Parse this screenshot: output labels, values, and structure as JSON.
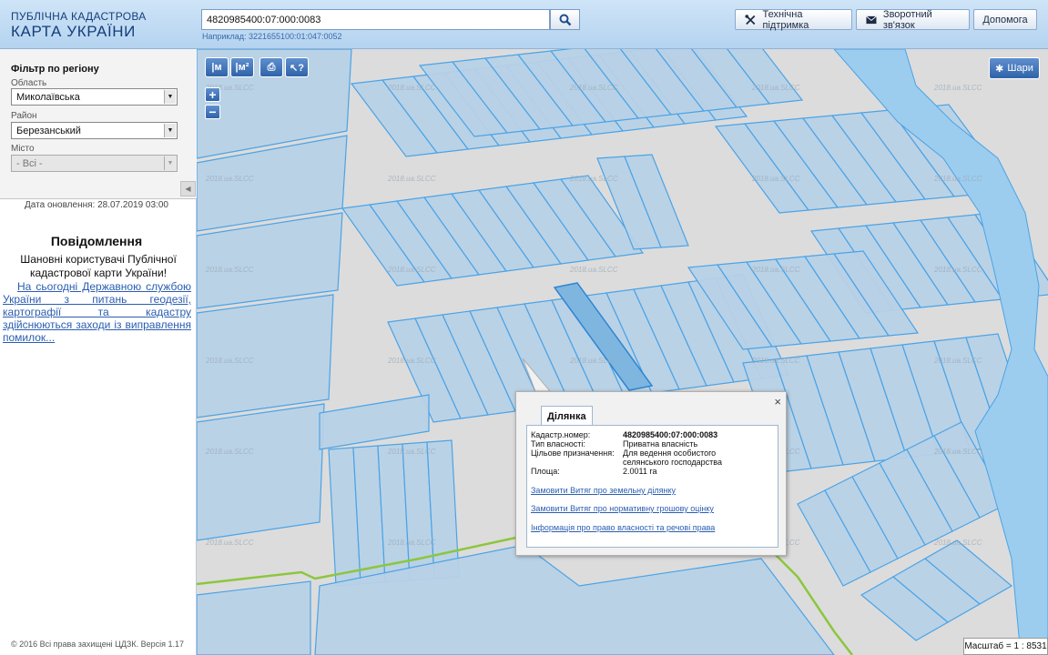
{
  "header": {
    "logo_line1": "ПУБЛІЧНА КАДАСТРОВА",
    "logo_line2": "КАРТА УКРАЇНИ",
    "search_value": "4820985400:07:000:0083",
    "example": "Наприклад: 3221655100:01:047:0052",
    "buttons": {
      "support": "Технічна підтримка",
      "feedback": "Зворотний зв'язок",
      "help": "Допомога"
    }
  },
  "sidebar": {
    "filter_title": "Фільтр по регіону",
    "oblast_label": "Область",
    "oblast_value": "Миколаївська",
    "rayon_label": "Район",
    "rayon_value": "Березанський",
    "city_label": "Місто",
    "city_value": "- Всі -",
    "updated": "Дата оновлення: 28.07.2019 03:00",
    "notice_title": "Повідомлення",
    "notice_text": "Шановні користувачі Публічної кадастрової карти України!",
    "notice_link": "На сьогодні Державною службою України з питань геодезії, картографії та кадастру здійснюються заходи із виправлення помилок...",
    "copyright": "© 2016 Всі права захищені ЦДЗК. Версія 1.17"
  },
  "map": {
    "tools": {
      "measure_line": "|м",
      "measure_area": "|м²",
      "print": "⎙",
      "identify": "↖?"
    },
    "zoom_in": "+",
    "zoom_out": "−",
    "layers": "Шари",
    "scale": "Масштаб = 1 : 8531",
    "watermark": "2018.ua.SLCC",
    "colors": {
      "parcel_fill": "#b7d1e6",
      "parcel_stroke": "#4aa3e6",
      "river": "#9ccdee",
      "road": "#9ccc3c",
      "background": "#dcdcdc"
    }
  },
  "popup": {
    "tab": "Ділянка",
    "close": "×",
    "fields": [
      {
        "label": "Кадастр.номер:",
        "value": "4820985400:07:000:0083"
      },
      {
        "label": "Тип власності:",
        "value": "Приватна власність"
      },
      {
        "label": "Цільове призначення:",
        "value": "Для ведення особистого селянського господарства"
      },
      {
        "label": "Площа:",
        "value": "2.0011 га"
      }
    ],
    "links": [
      "Замовити Витяг про земельну ділянку",
      "Замовити Витяг про нормативну грошову оцінку",
      "Інформація про право власності та речові права"
    ]
  }
}
